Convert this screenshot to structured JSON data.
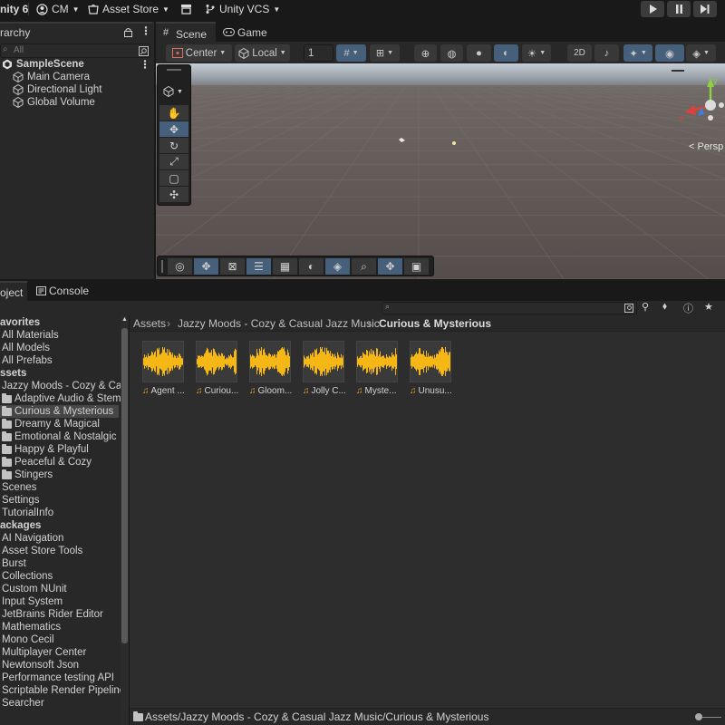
{
  "topbar": {
    "app_title": "nity 6",
    "account": "CM",
    "asset_store": "Asset Store",
    "vcs": "Unity VCS"
  },
  "hierarchy": {
    "tab_label": "rarchy",
    "search_placeholder": "All",
    "scene_name": "SampleScene",
    "objects": [
      "Main Camera",
      "Directional Light",
      "Global Volume"
    ]
  },
  "scene": {
    "tabs": [
      "Scene",
      "Game"
    ],
    "pivot_mode": "Center",
    "pivot_space": "Local",
    "grid_value": "1",
    "persp_label": "< Persp",
    "gizmo_axes": {
      "x": "x",
      "y": "y"
    }
  },
  "project": {
    "tabs": [
      "oject",
      "Console"
    ],
    "breadcrumb": [
      "Assets",
      "Jazzy Moods - Cozy & Casual Jazz Music",
      "Curious & Mysterious"
    ],
    "tree": [
      {
        "label": "avorites",
        "type": "header"
      },
      {
        "label": "All Materials",
        "type": "item"
      },
      {
        "label": "All Models",
        "type": "item"
      },
      {
        "label": "All Prefabs",
        "type": "item"
      },
      {
        "label": "ssets",
        "type": "header"
      },
      {
        "label": "Jazzy Moods - Cozy & Ca",
        "type": "item"
      },
      {
        "label": "Adaptive Audio & Stems",
        "type": "folder"
      },
      {
        "label": "Curious & Mysterious",
        "type": "folder",
        "selected": true
      },
      {
        "label": "Dreamy & Magical",
        "type": "folder"
      },
      {
        "label": "Emotional & Nostalgic",
        "type": "folder"
      },
      {
        "label": "Happy & Playful",
        "type": "folder"
      },
      {
        "label": "Peaceful & Cozy",
        "type": "folder"
      },
      {
        "label": "Stingers",
        "type": "folder"
      },
      {
        "label": "Scenes",
        "type": "item"
      },
      {
        "label": "Settings",
        "type": "item"
      },
      {
        "label": "TutorialInfo",
        "type": "item"
      },
      {
        "label": "ackages",
        "type": "header"
      },
      {
        "label": "AI Navigation",
        "type": "item"
      },
      {
        "label": "Asset Store Tools",
        "type": "item"
      },
      {
        "label": "Burst",
        "type": "item"
      },
      {
        "label": "Collections",
        "type": "item"
      },
      {
        "label": "Custom NUnit",
        "type": "item"
      },
      {
        "label": "Input System",
        "type": "item"
      },
      {
        "label": "JetBrains Rider Editor",
        "type": "item"
      },
      {
        "label": "Mathematics",
        "type": "item"
      },
      {
        "label": "Mono Cecil",
        "type": "item"
      },
      {
        "label": "Multiplayer Center",
        "type": "item"
      },
      {
        "label": "Newtonsoft Json",
        "type": "item"
      },
      {
        "label": "Performance testing API",
        "type": "item"
      },
      {
        "label": "Scriptable Render Pipeline",
        "type": "item"
      },
      {
        "label": "Searcher",
        "type": "item"
      }
    ],
    "assets": [
      "Agent ...",
      "Curiou...",
      "Gloom...",
      "Jolly C...",
      "Myste...",
      "Unusu..."
    ],
    "status_path": "Assets/Jazzy Moods - Cozy & Casual Jazz Music/Curious & Mysterious"
  },
  "colors": {
    "waveform": "#f5b716",
    "selected_tool": "#46607c",
    "axis_x": "#e0403a",
    "axis_y": "#8fd13f",
    "axis_z": "#3b7de0"
  }
}
